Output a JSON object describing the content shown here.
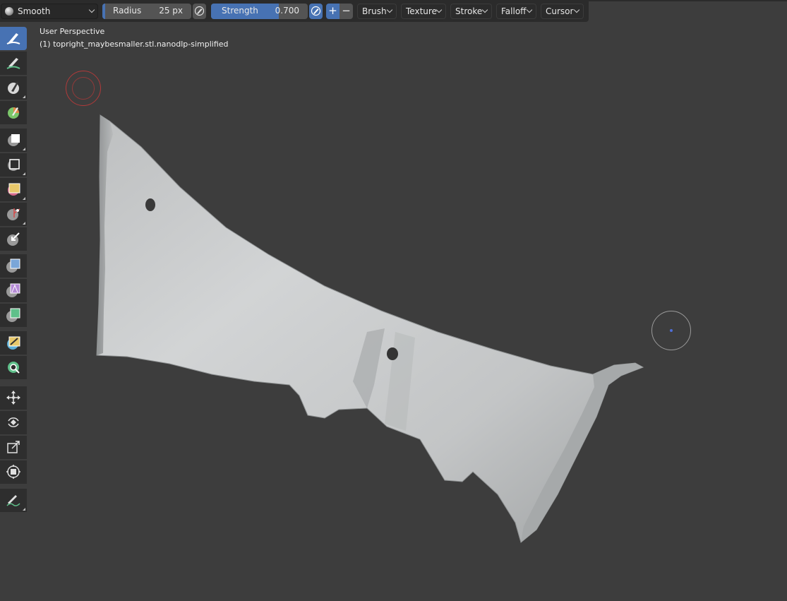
{
  "header": {
    "brush": {
      "name": "Smooth"
    },
    "radius": {
      "label": "Radius",
      "value": "25 px"
    },
    "strength": {
      "label": "Strength",
      "value": "0.700",
      "fraction": 0.7
    },
    "direction": {
      "add": "+",
      "subtract": "−"
    },
    "menus": [
      "Brush",
      "Texture",
      "Stroke",
      "Falloff",
      "Cursor"
    ]
  },
  "viewport": {
    "title": "User Perspective",
    "object": "(1) topright_maybesmaller.stl.nanodlp-simplified"
  },
  "toolbar": {
    "tools": [
      {
        "name": "smooth-brush-icon",
        "active": true
      },
      {
        "name": "draw-brush-icon"
      },
      {
        "name": "mask-brush-icon"
      },
      {
        "name": "paint-brush-icon"
      },
      {
        "name": "box-mask-icon"
      },
      {
        "name": "box-hide-icon"
      },
      {
        "name": "box-face-set-icon"
      },
      {
        "name": "box-trim-icon"
      },
      {
        "name": "line-project-icon"
      },
      {
        "name": "mesh-filter-icon"
      },
      {
        "name": "cloth-filter-icon"
      },
      {
        "name": "color-filter-icon"
      },
      {
        "name": "edit-face-set-icon"
      },
      {
        "name": "mask-by-color-icon"
      },
      {
        "name": "move-icon"
      },
      {
        "name": "rotate-icon"
      },
      {
        "name": "scale-icon"
      },
      {
        "name": "transform-icon"
      },
      {
        "name": "annotate-icon"
      }
    ]
  },
  "colors": {
    "accent": "#4772b3",
    "background": "#3d3d3d",
    "header": "#2b2b2b",
    "mesh": "#c9cbcc"
  }
}
